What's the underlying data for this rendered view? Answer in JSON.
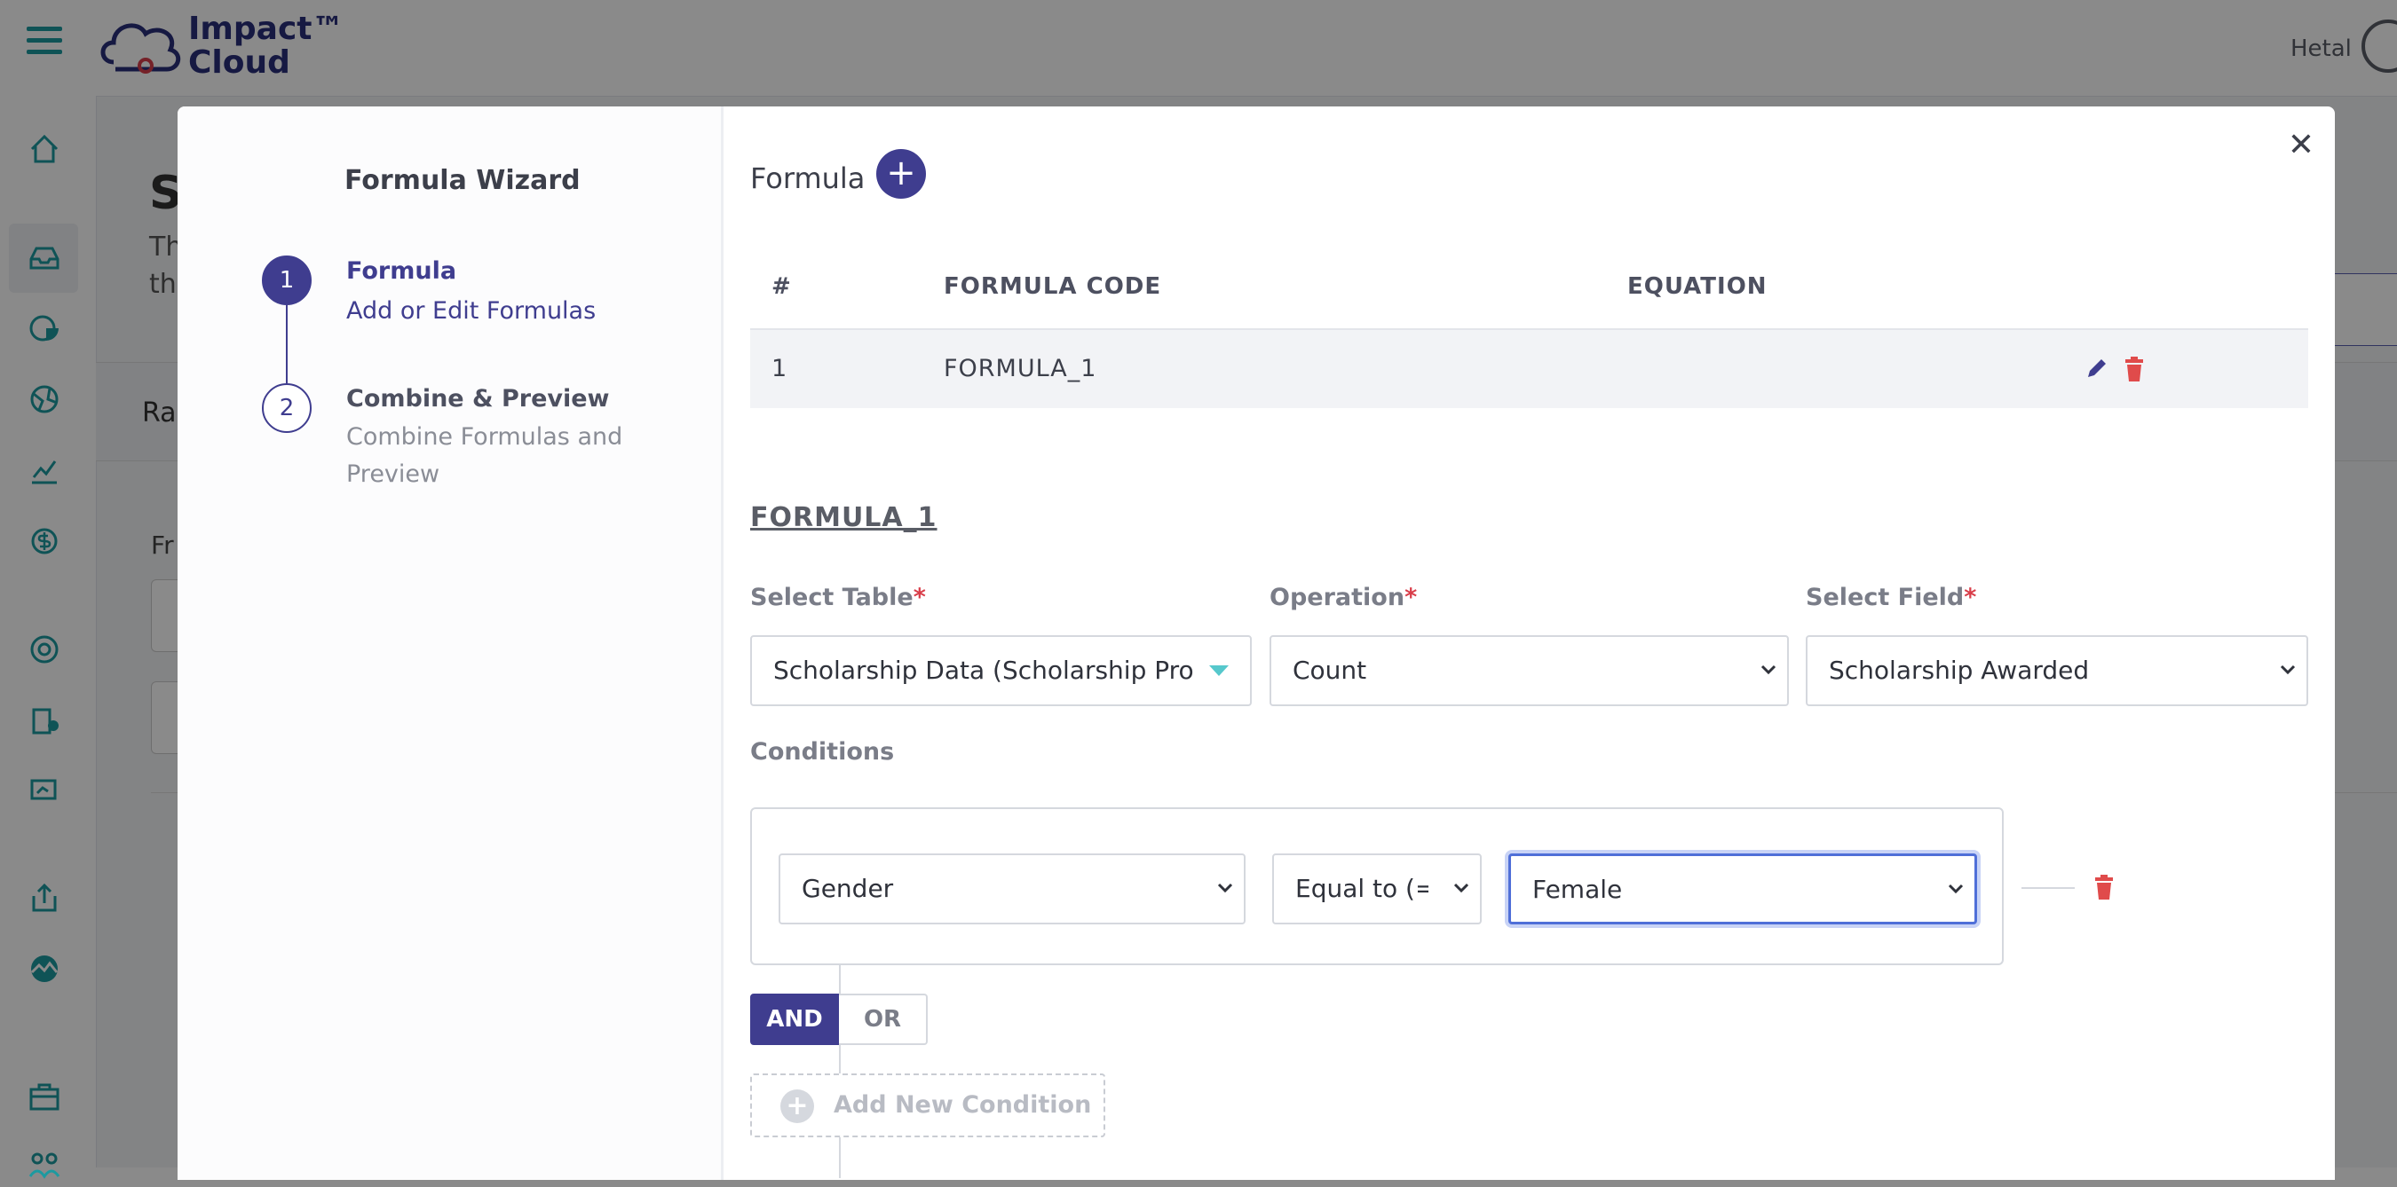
{
  "header": {
    "logo_text_line1": "Impact™",
    "logo_text_line2": "Cloud",
    "user_name": "Hetal"
  },
  "background": {
    "title_fragment": "S",
    "desc_line1": "Th",
    "desc_line2": "th",
    "panel_label": "Ra",
    "filter_label": "Fr"
  },
  "wizard": {
    "title": "Formula Wizard",
    "steps": [
      {
        "number": "1",
        "title": "Formula",
        "subtitle": "Add or Edit Formulas"
      },
      {
        "number": "2",
        "title": "Combine & Preview",
        "subtitle": "Combine Formulas and Preview"
      }
    ]
  },
  "formula_section": {
    "title": "Formula",
    "table": {
      "headers": [
        "#",
        "FORMULA CODE",
        "EQUATION"
      ],
      "rows": [
        {
          "index": "1",
          "code": "FORMULA_1",
          "equation": ""
        }
      ]
    }
  },
  "editor": {
    "formula_code": "FORMULA_1",
    "select_table": {
      "label": "Select Table",
      "value": "Scholarship Data (Scholarship Pro"
    },
    "operation": {
      "label": "Operation",
      "value": "Count"
    },
    "select_field": {
      "label": "Select Field",
      "value": "Scholarship Awarded"
    },
    "conditions_label": "Conditions",
    "condition": {
      "field": "Gender",
      "operator": "Equal to (=)",
      "value": "Female"
    },
    "logic": {
      "and": "AND",
      "or": "OR",
      "active": "AND"
    },
    "add_condition_label": "Add New Condition"
  },
  "colors": {
    "accent": "#3f3d8f",
    "danger": "#e04b4b",
    "teal": "#1c9aa0",
    "focus": "#4f6fd8"
  }
}
